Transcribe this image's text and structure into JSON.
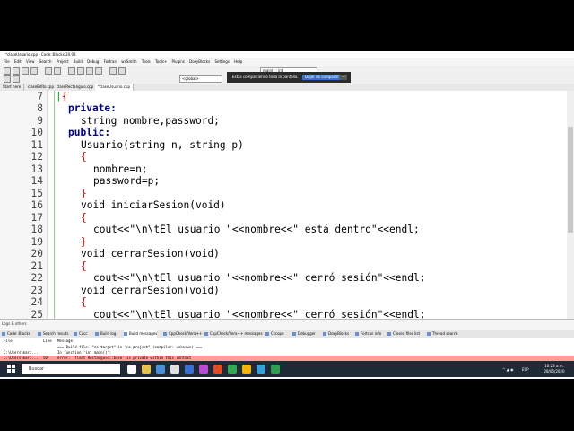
{
  "window": {
    "title": "*claseUsuario.cpp - Code::Blocks 20.03"
  },
  "menu": [
    "File",
    "Edit",
    "View",
    "Search",
    "Project",
    "Build",
    "Debug",
    "Fortran",
    "wxSmith",
    "Tools",
    "Tools+",
    "Plugins",
    "DoxyBlocks",
    "Settings",
    "Help"
  ],
  "toolbar": {
    "scope_combo": "<global>",
    "function_combo": "main() : int"
  },
  "share_bar": {
    "message": "Estás compartiendo toda la pantalla.",
    "stop_label": "Dejar de compartir",
    "hide_label": "—"
  },
  "tabs": [
    "Start here",
    "claseEdito.cpp",
    "claseRectangulo.cpp",
    "*claseUsuario.cpp"
  ],
  "code": [
    {
      "n": "7",
      "text": "{"
    },
    {
      "n": "8",
      "text": "private:"
    },
    {
      "n": "9",
      "text": "string nombre,password;"
    },
    {
      "n": "10",
      "text": "public:"
    },
    {
      "n": "11",
      "text": "Usuario(string n, string p)"
    },
    {
      "n": "12",
      "text": "{"
    },
    {
      "n": "13",
      "text": "nombre=n;"
    },
    {
      "n": "14",
      "text": "password=p;"
    },
    {
      "n": "15",
      "text": "}"
    },
    {
      "n": "16",
      "text": "void iniciarSesion(void)"
    },
    {
      "n": "17",
      "text": "{"
    },
    {
      "n": "18",
      "text": "cout<<\"\\n\\tEl usuario \"<<nombre<<\" está dentro\"<<endl;"
    },
    {
      "n": "19",
      "text": "}"
    },
    {
      "n": "20",
      "text": "void cerrarSesion(void)"
    },
    {
      "n": "21",
      "text": "{"
    },
    {
      "n": "22",
      "text": "cout<<\"\\n\\tEl usuario \"<<nombre<<\" cerró sesión\"<<endl;"
    },
    {
      "n": "23",
      "text": "void cerrarSesion(void)"
    },
    {
      "n": "24",
      "text": "{"
    },
    {
      "n": "25",
      "text": "cout<<\"\\n\\tEl usuario \"<<nombre<<\" cerró sesión\"<<endl;"
    }
  ],
  "logs": {
    "title": "Logs & others",
    "tabs": [
      "Code::Blocks",
      "Search results",
      "Cccc",
      "Build log",
      "Build messages",
      "CppCheck/Vera++",
      "CppCheck/Vera++ messages",
      "Cscope",
      "Debugger",
      "DoxyBlocks",
      "Fortran info",
      "Closed files list",
      "Thread search"
    ],
    "columns": [
      "File",
      "Line",
      "Message"
    ],
    "rows": [
      {
        "file": "",
        "line": "",
        "message": "=== Build file: \"no target\" in \"no project\" (compiler: unknown) ===",
        "error": false
      },
      {
        "file": "C:\\Users\\marc...",
        "line": "",
        "message": "In function 'int main()':",
        "error": false
      },
      {
        "file": "C:\\Users\\marc...",
        "line": "50",
        "message": "error: 'float Rectangulo::base' is private within this context",
        "error": true
      }
    ]
  },
  "taskbar": {
    "search_placeholder": "Buscar",
    "time": "10:23 a.m.",
    "date": "28/05/2020",
    "lang": "ESP"
  }
}
